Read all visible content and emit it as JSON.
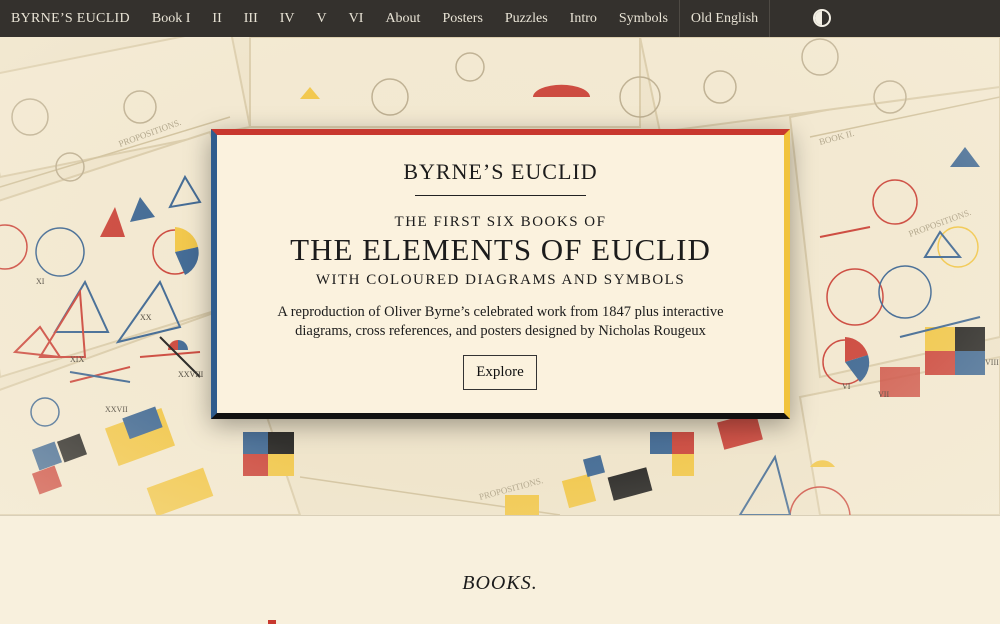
{
  "nav": {
    "brand": "BYRNE’S EUCLID",
    "items": [
      "Book I",
      "II",
      "III",
      "IV",
      "V",
      "VI",
      "About",
      "Posters",
      "Puzzles",
      "Intro",
      "Symbols"
    ],
    "language": "Old English",
    "theme_toggle_icon": "contrast-icon"
  },
  "hero": {
    "title": "BYRNE’S EUCLID",
    "kicker": "THE FIRST SIX BOOKS OF",
    "heading": "THE ELEMENTS OF EUCLID",
    "subheading": "WITH COLOURED DIAGRAMS AND SYMBOLS",
    "description": "A reproduction of Oliver Byrne’s celebrated work from 1847 plus interactive diagrams, cross references, and posters designed by Nicholas Rougeux",
    "button": "Explore"
  },
  "books": {
    "title": "BOOKS."
  },
  "colors": {
    "red": "#c8382e",
    "blue": "#2f5c8d",
    "yellow": "#f1c33b",
    "black": "#111111",
    "nav_bg": "#34312d",
    "cream": "#f8f0dd"
  }
}
